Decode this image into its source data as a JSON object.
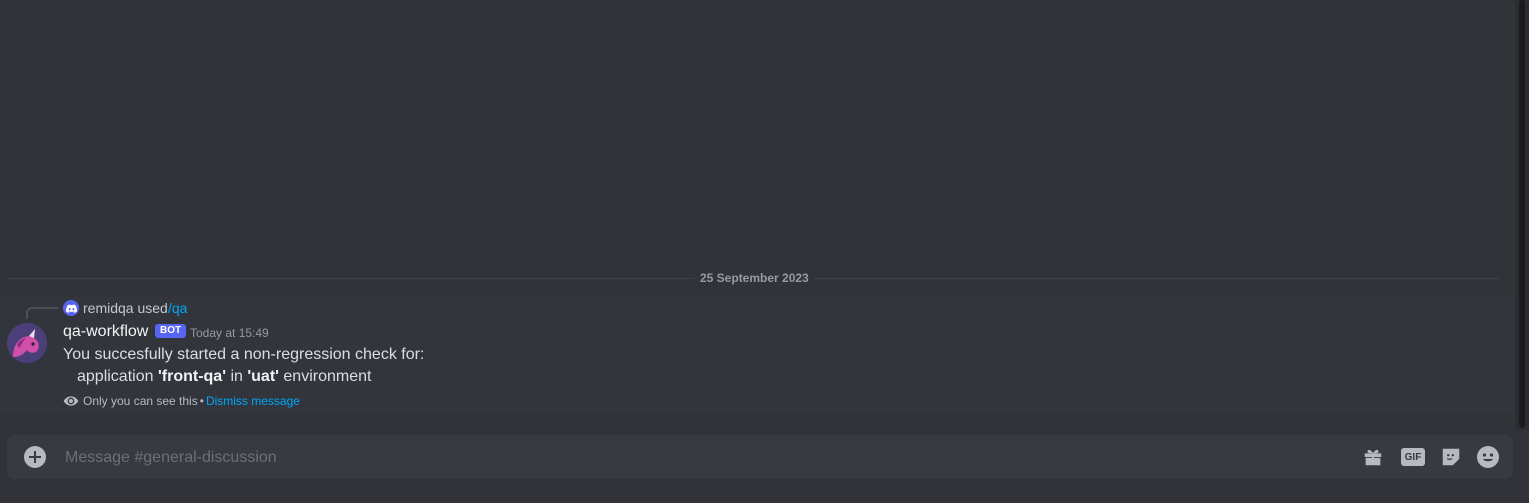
{
  "divider": {
    "date": "25 September 2023"
  },
  "reply": {
    "user": "remidqa used",
    "command": "/qa"
  },
  "message": {
    "author": "qa-workflow",
    "badge": "BOT",
    "timestamp": "Today at 15:49",
    "line1": "You succesfully started a non-regression check for:",
    "line2_parts": [
      "application ",
      "'front-qa'",
      " in ",
      "'uat'",
      " environment"
    ],
    "ephemeral_note": "Only you can see this",
    "separator": "•",
    "dismiss_label": "Dismiss message"
  },
  "composer": {
    "placeholder": "Message #general-discussion",
    "gif_label": "GIF",
    "icons": [
      "plus-circle-icon",
      "gift-icon",
      "gif-icon",
      "sticker-icon",
      "emoji-icon"
    ]
  },
  "colors": {
    "background": "#313338",
    "message_highlight": "#32353b",
    "accent": "#5865f2",
    "link": "#00a8fc"
  }
}
